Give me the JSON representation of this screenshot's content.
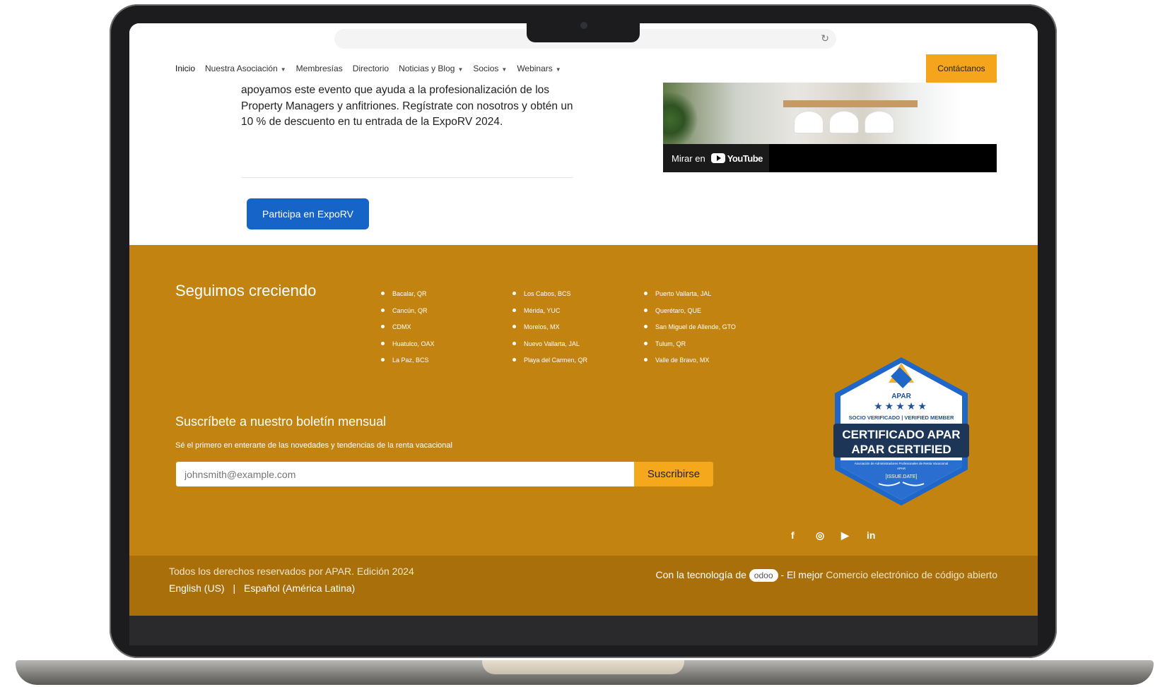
{
  "nav": {
    "items": [
      {
        "label": "Inicio",
        "dropdown": false
      },
      {
        "label": "Nuestra Asociación",
        "dropdown": true
      },
      {
        "label": "Membresías",
        "dropdown": false
      },
      {
        "label": "Directorio",
        "dropdown": false
      },
      {
        "label": "Noticias y  Blog",
        "dropdown": true
      },
      {
        "label": "Socios",
        "dropdown": true
      },
      {
        "label": "Webinars",
        "dropdown": true
      }
    ],
    "contact_label": "Contáctanos"
  },
  "content": {
    "paragraph": "apoyamos este evento que ayuda a la profesionalización de los Property Managers y anfitriones. Regístrate con nosotros y obtén un 10 % de descuento en tu entrada de la ExpoRV 2024.",
    "cta_label": "Participa en ExpoRV",
    "video_watch_label": "Mirar en",
    "video_platform": "YouTube"
  },
  "footer": {
    "title": "Seguimos creciendo",
    "cities_col1": [
      "Bacalar, QR",
      "Cancún, QR",
      "CDMX",
      "Huatulco, OAX",
      "La Paz, BCS"
    ],
    "cities_col2": [
      "Los Cabos, BCS",
      "Mérida, YUC",
      "Morelos, MX",
      "Nuevo Vallarta, JAL",
      "Playa del Carmen, QR"
    ],
    "cities_col3": [
      "Puerto Vallarta, JAL",
      "Querétaro, QUE",
      "San Miguel de Allende, GTO",
      "Tulum, QR",
      "Valle de Bravo, MX"
    ],
    "newsletter_title": "Suscríbete a nuestro boletín mensual",
    "newsletter_sub": "Sé el primero en enterarte de las novedades y tendencias de la renta vacacional",
    "email_placeholder": "johnsmith@example.com",
    "subscribe_label": "Suscribirse",
    "badge": {
      "brand": "APAR",
      "stars": "★★★★★",
      "verified": "SOCIO VERIFICADO | VERIFIED MEMBER",
      "line1": "CERTIFICADO APAR",
      "line2": "APAR CERTIFIED",
      "org": "Asociación de Administradores Profesionales de Renta Vacacional",
      "org_short": "APAR",
      "date": "[ISSUE.DATE]"
    },
    "social": {
      "facebook": "f",
      "instagram": "◎",
      "youtube": "▶",
      "linkedin": "in"
    }
  },
  "bottom": {
    "copyright": "Todos los derechos reservados por APAR. Edición 2024",
    "lang_en": "English (US)",
    "lang_sep": "|",
    "lang_es": "Español (América Latina)",
    "powered_prefix": "Con la tecnología de",
    "powered_brand": "odoo",
    "powered_mid": "- El mejor",
    "powered_link": "Comercio electrónico de código abierto"
  },
  "colors": {
    "footer": "#c38310",
    "accent": "#f5a51b",
    "cta": "#1764c8"
  }
}
